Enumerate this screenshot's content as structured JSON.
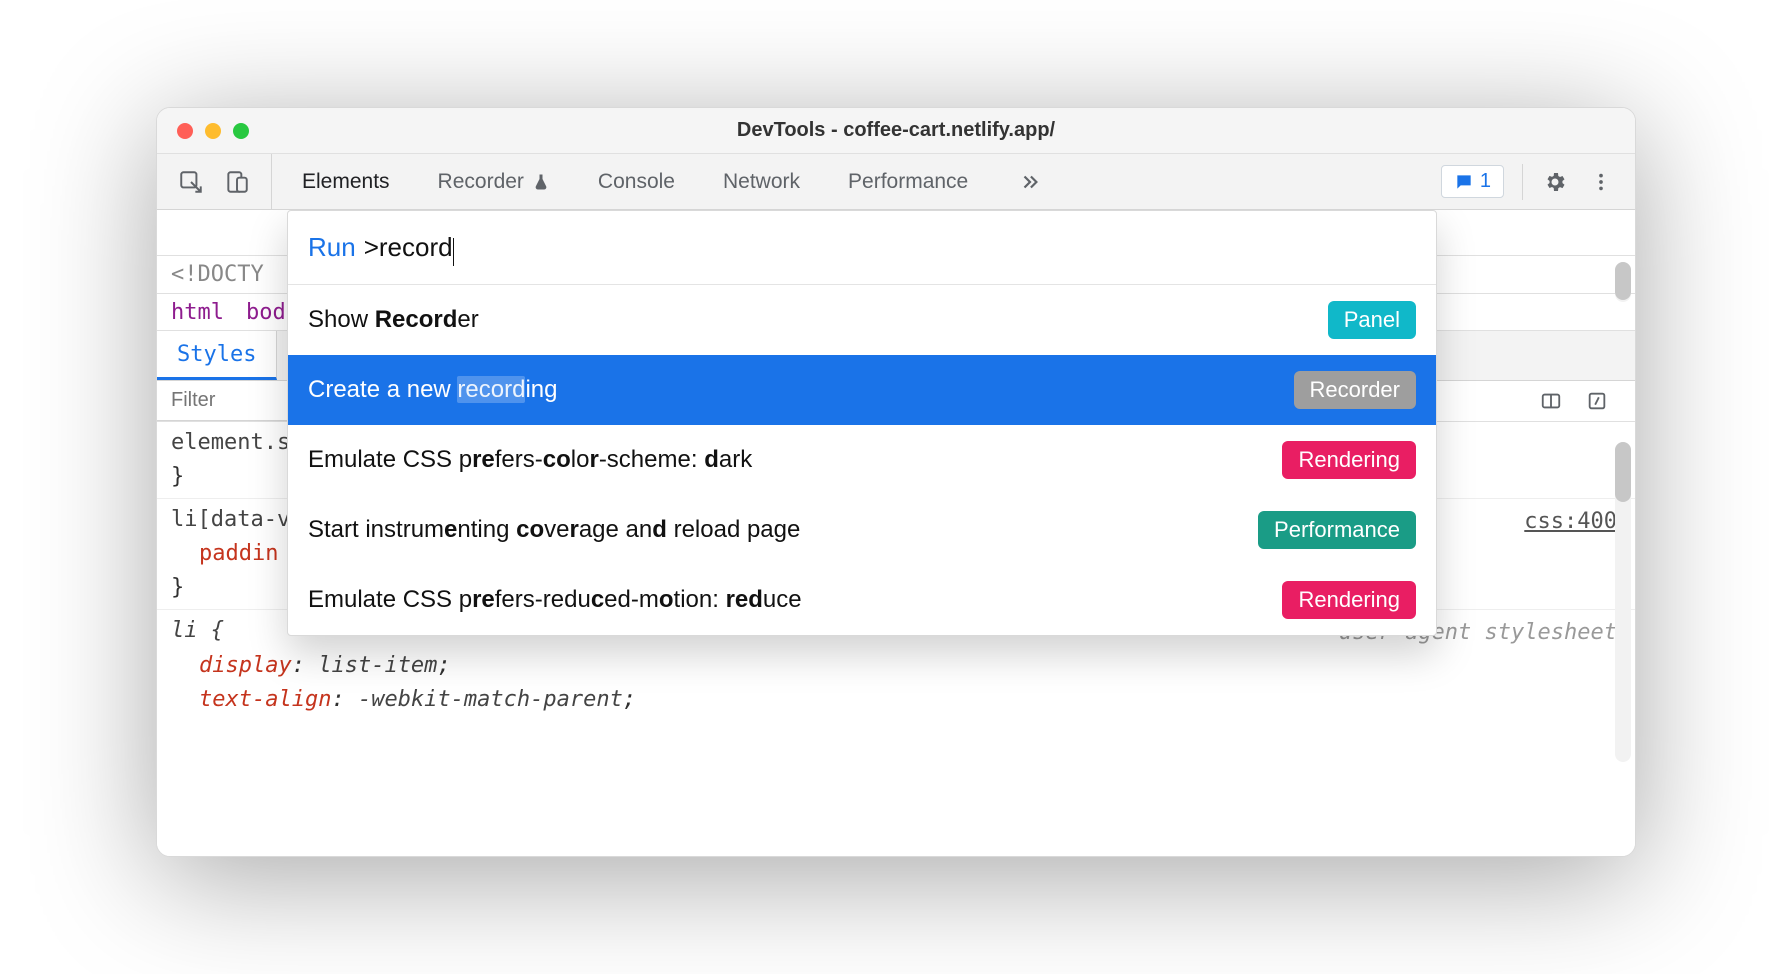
{
  "window": {
    "title": "DevTools - coffee-cart.netlify.app/"
  },
  "tabbar": {
    "tabs": [
      "Elements",
      "Recorder",
      "Console",
      "Network",
      "Performance"
    ],
    "more_icon": "chevrons-right",
    "issues_count": "1"
  },
  "palette": {
    "prefix": "Run",
    "query": ">record",
    "items": [
      {
        "label_html": "Show <b>Record</b>er",
        "badge": "Panel",
        "badge_class": "panel"
      },
      {
        "label_html": "Create a new <span class='hl'>record</span>ing",
        "badge": "Recorder",
        "badge_class": "recorder",
        "selected": true
      },
      {
        "label_html": "Emulate CSS p<b>re</b>fers-<b>co</b>lo<b>r</b>-scheme: <b>d</b>ark",
        "badge": "Rendering",
        "badge_class": "rendering"
      },
      {
        "label_html": "Start instrum<b>e</b>nting <b>co</b>ve<b>r</b>age an<b>d</b> reload page",
        "badge": "Performance",
        "badge_class": "performance"
      },
      {
        "label_html": "Emulate CSS p<b>re</b>fers-redu<b>c</b>ed-m<b>o</b>tion: <b>red</b>uce",
        "badge": "Rendering",
        "badge_class": "rendering"
      }
    ]
  },
  "elements": {
    "doctype_snippet": "<!DOCTY",
    "breadcrumb": [
      "html",
      "bod"
    ],
    "styles_tab": "Styles",
    "filter_placeholder": "Filter"
  },
  "styles": {
    "rules": [
      {
        "selector": "element.s",
        "body": "}",
        "source": ""
      },
      {
        "selector": "li[data-v",
        "prop": "paddin",
        "body": "}",
        "source": "css:400"
      },
      {
        "selector": "li {",
        "prop1": "display",
        "val1": "list-item",
        "prop2": "text-align",
        "val2": "-webkit-match-parent",
        "ua": "user agent stylesheet"
      }
    ]
  }
}
